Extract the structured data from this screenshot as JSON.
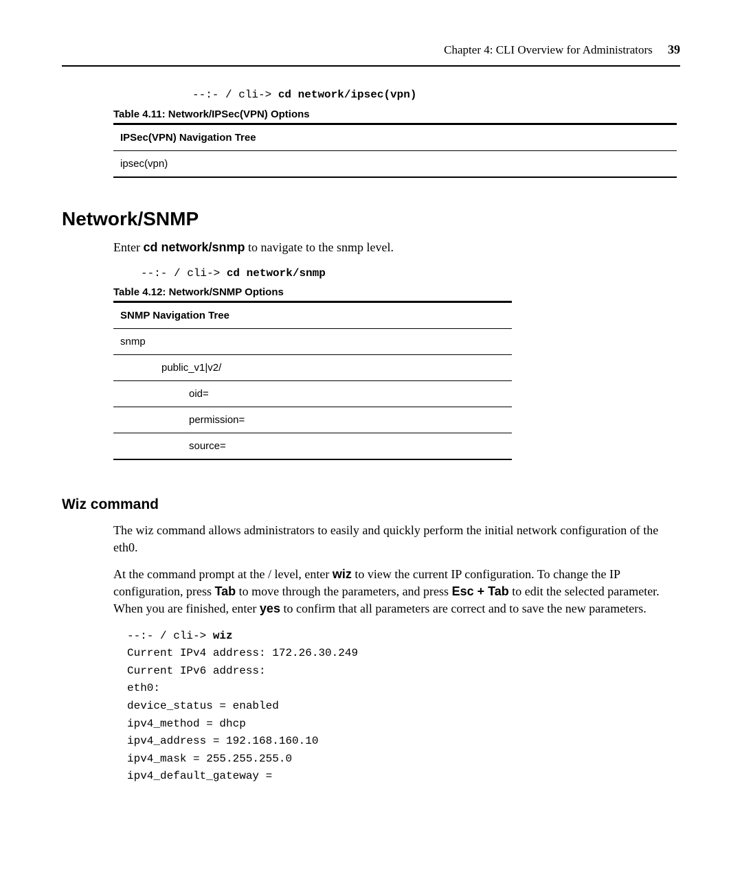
{
  "header": {
    "chapter": "Chapter 4: CLI Overview for Administrators",
    "page": "39"
  },
  "ipsec": {
    "cmd_prefix": "--:- / cli-> ",
    "cmd": "cd network/ipsec(vpn)",
    "table_caption": "Table 4.11: Network/IPSec(VPN) Options",
    "table_header": "IPSec(VPN) Navigation Tree",
    "rows": [
      "ipsec(vpn)"
    ]
  },
  "snmp_section": {
    "heading": "Network/SNMP",
    "intro_pre": "Enter ",
    "intro_cmd": "cd network/snmp",
    "intro_post": " to navigate to the snmp level.",
    "cmd_prefix": "--:- / cli-> ",
    "cmd": "cd network/snmp",
    "table_caption": "Table 4.12: Network/SNMP Options",
    "table_header": "SNMP Navigation Tree",
    "rows": {
      "r0": "snmp",
      "r1": "public_v1|v2/",
      "r2": "oid=",
      "r3": "permission=",
      "r4": "source="
    }
  },
  "wiz": {
    "heading": "Wiz command",
    "p1": "The wiz command allows administrators to easily and quickly perform the initial network configuration of the eth0.",
    "p2_a": "At the command prompt at the / level, enter ",
    "p2_wiz": "wiz",
    "p2_b": " to view the current IP configuration. To change the IP configuration, press ",
    "p2_tab": "Tab",
    "p2_c": " to move through the parameters, and press ",
    "p2_esc": "Esc + Tab",
    "p2_d": " to edit the selected parameter. When you are finished, enter ",
    "p2_yes": "yes",
    "p2_e": " to confirm that all parameters are correct and to save the new parameters.",
    "code": {
      "l1a": "--:- / cli-> ",
      "l1b": "wiz",
      "l2": "Current IPv4 address: 172.26.30.249",
      "l3": "Current IPv6 address:",
      "l4": "eth0:",
      "l5": "device_status = enabled",
      "l6": "ipv4_method = dhcp",
      "l7": "ipv4_address = 192.168.160.10",
      "l8": "ipv4_mask = 255.255.255.0",
      "l9": "ipv4_default_gateway ="
    }
  }
}
